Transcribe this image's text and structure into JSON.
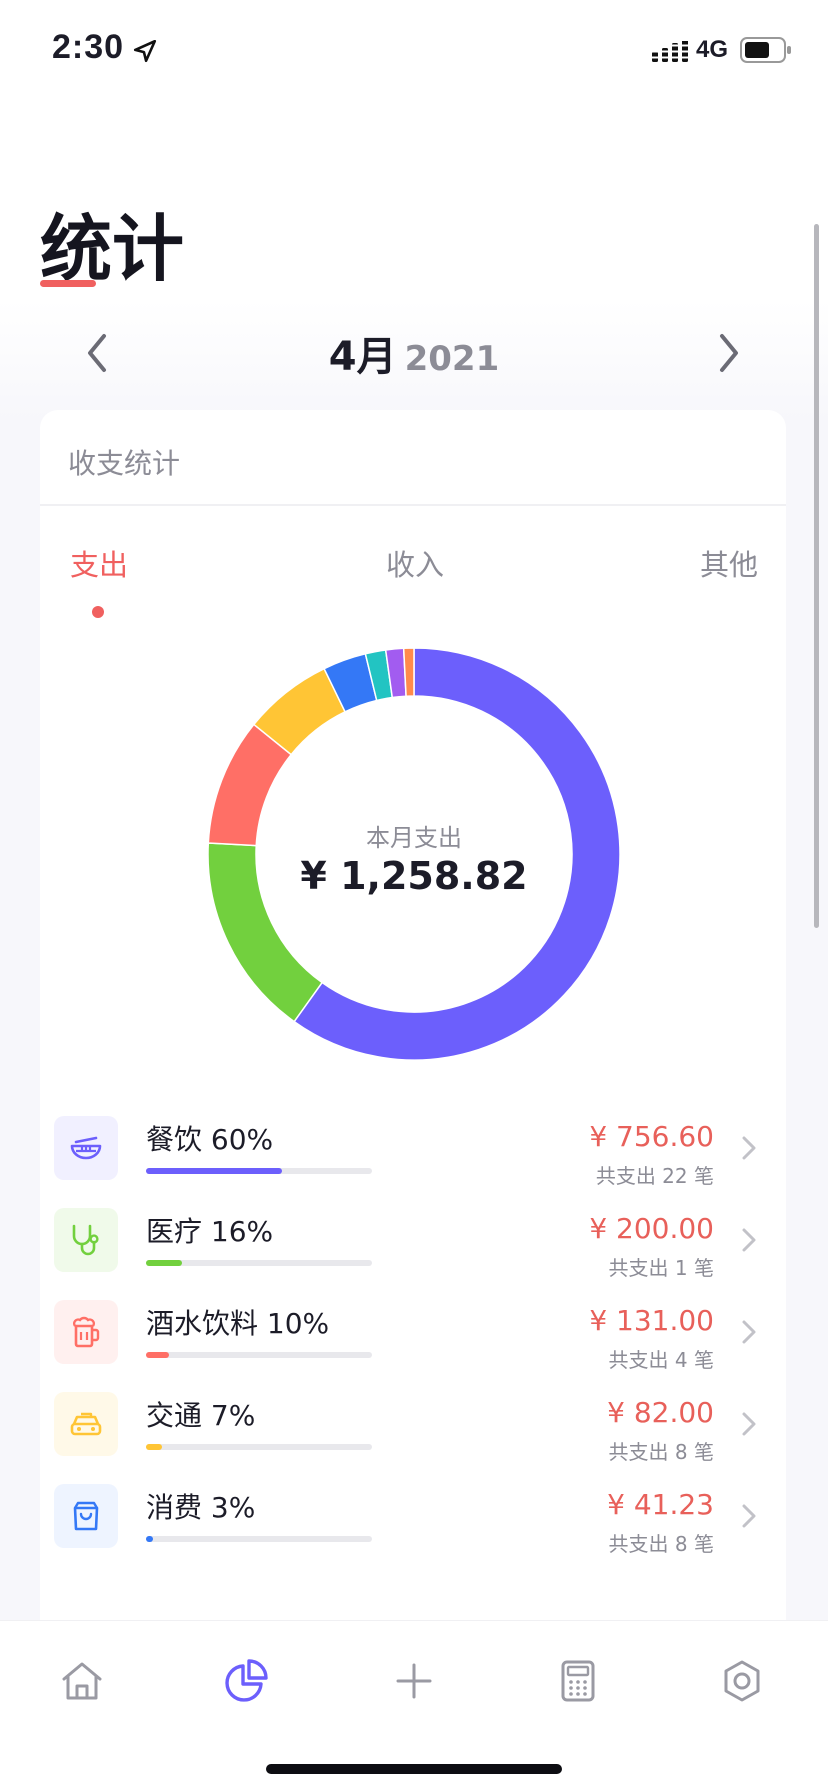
{
  "status_bar": {
    "time": "2:30",
    "network": "4G"
  },
  "header": {
    "title": "统计"
  },
  "month_nav": {
    "month": "4月",
    "year": "2021"
  },
  "card": {
    "title": "收支统计",
    "tabs": [
      {
        "label": "支出",
        "active": true
      },
      {
        "label": "收入",
        "active": false
      },
      {
        "label": "其他",
        "active": false
      }
    ],
    "donut": {
      "subtitle": "本月支出",
      "total": "¥ 1,258.82",
      "segments": [
        {
          "value": 60,
          "color": "#6C5FFC"
        },
        {
          "value": 16,
          "color": "#72D03E"
        },
        {
          "value": 10,
          "color": "#FF6F66"
        },
        {
          "value": 7,
          "color": "#FFC535"
        },
        {
          "value": 3.4,
          "color": "#3478F6"
        },
        {
          "value": 1.6,
          "color": "#22C4C2"
        },
        {
          "value": 1.4,
          "color": "#A25CF0"
        },
        {
          "value": 0.8,
          "color": "#FF8A4C"
        }
      ]
    },
    "categories": [
      {
        "name": "餐饮 60%",
        "percent": 60,
        "amount": "¥ 756.60",
        "count": "共支出 22 笔",
        "color": "#6C5FFC",
        "icon_bg": "#F1F0FF",
        "icon": "bowl-icon"
      },
      {
        "name": "医疗 16%",
        "percent": 16,
        "amount": "¥ 200.00",
        "count": "共支出 1 笔",
        "color": "#72D03E",
        "icon_bg": "#F0FAEA",
        "icon": "stethoscope-icon"
      },
      {
        "name": "酒水饮料 10%",
        "percent": 10,
        "amount": "¥ 131.00",
        "count": "共支出 4 笔",
        "color": "#FF6F66",
        "icon_bg": "#FFF0EF",
        "icon": "beer-icon"
      },
      {
        "name": "交通 7%",
        "percent": 7,
        "amount": "¥ 82.00",
        "count": "共支出 8 笔",
        "color": "#FFC535",
        "icon_bg": "#FFF9E8",
        "icon": "taxi-icon"
      },
      {
        "name": "消费 3%",
        "percent": 3,
        "amount": "¥ 41.23",
        "count": "共支出 8 笔",
        "color": "#3478F6",
        "icon_bg": "#EEF4FF",
        "icon": "shopping-bag-icon"
      }
    ]
  },
  "tab_bar": [
    {
      "icon": "home-icon"
    },
    {
      "icon": "pie-chart-icon",
      "active": true
    },
    {
      "icon": "plus-icon"
    },
    {
      "icon": "calculator-icon"
    },
    {
      "icon": "gear-icon"
    }
  ]
}
